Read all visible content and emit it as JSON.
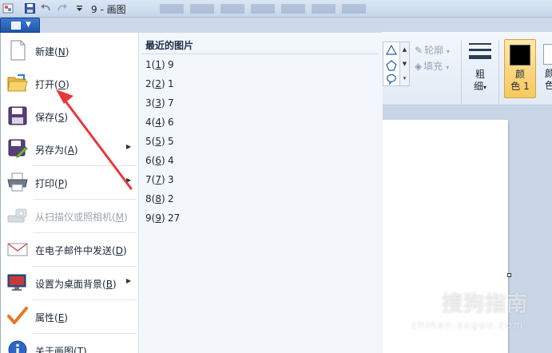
{
  "window": {
    "title": "9 - 画图"
  },
  "quick_access": [
    {
      "icon": "paint-app-icon"
    },
    {
      "icon": "save-icon"
    },
    {
      "icon": "undo-icon"
    },
    {
      "icon": "redo-icon"
    },
    {
      "icon": "customize-caret-icon"
    }
  ],
  "menu": {
    "items": [
      {
        "label": "新建",
        "key": "N",
        "icon": "new-file-icon",
        "enabled": true,
        "submenu": false
      },
      {
        "label": "打开",
        "key": "O",
        "icon": "open-folder-icon",
        "enabled": true,
        "submenu": false
      },
      {
        "label": "保存",
        "key": "S",
        "icon": "save-disk-icon",
        "enabled": true,
        "submenu": false
      },
      {
        "label": "另存为",
        "key": "A",
        "icon": "save-as-icon",
        "enabled": true,
        "submenu": true
      },
      {
        "label": "打印",
        "key": "P",
        "icon": "printer-icon",
        "enabled": true,
        "submenu": true
      },
      {
        "label": "从扫描仪或照相机",
        "key": "M",
        "icon": "scanner-camera-icon",
        "enabled": false,
        "submenu": false
      },
      {
        "label": "在电子邮件中发送",
        "key": "D",
        "icon": "email-icon",
        "enabled": true,
        "submenu": false
      },
      {
        "label": "设置为桌面背景",
        "key": "B",
        "icon": "desktop-background-icon",
        "enabled": true,
        "submenu": true
      },
      {
        "label": "属性",
        "key": "E",
        "icon": "properties-check-icon",
        "enabled": true,
        "submenu": false
      },
      {
        "label": "关于画图",
        "key": "T",
        "icon": "info-icon",
        "enabled": true,
        "submenu": false
      }
    ]
  },
  "recent": {
    "title": "最近的图片",
    "items": [
      {
        "index": "1",
        "key": "1",
        "name": "9"
      },
      {
        "index": "2",
        "key": "2",
        "name": "1"
      },
      {
        "index": "3",
        "key": "3",
        "name": "7"
      },
      {
        "index": "4",
        "key": "4",
        "name": "6"
      },
      {
        "index": "5",
        "key": "5",
        "name": "5"
      },
      {
        "index": "6",
        "key": "6",
        "name": "4"
      },
      {
        "index": "7",
        "key": "7",
        "name": "3"
      },
      {
        "index": "8",
        "key": "8",
        "name": "2"
      },
      {
        "index": "9",
        "key": "9",
        "name": "27"
      }
    ]
  },
  "ribbon": {
    "outline_label": "轮廓",
    "fill_label": "填充",
    "stroke_label_1": "粗",
    "stroke_label_2": "细",
    "color1_label_1": "颜",
    "color1_label_2": "色 1",
    "color2_label_1": "颜",
    "color2_label_2": "色",
    "color1_value": "#000000",
    "color2_value": "#ffffff"
  },
  "watermark": {
    "text": "搜狗指南",
    "sub": "zhinan.sogou.com"
  },
  "colors": {
    "accent": "#2a62b8",
    "annotation_arrow": "#e8383b",
    "highlight": "#f7c85e"
  }
}
